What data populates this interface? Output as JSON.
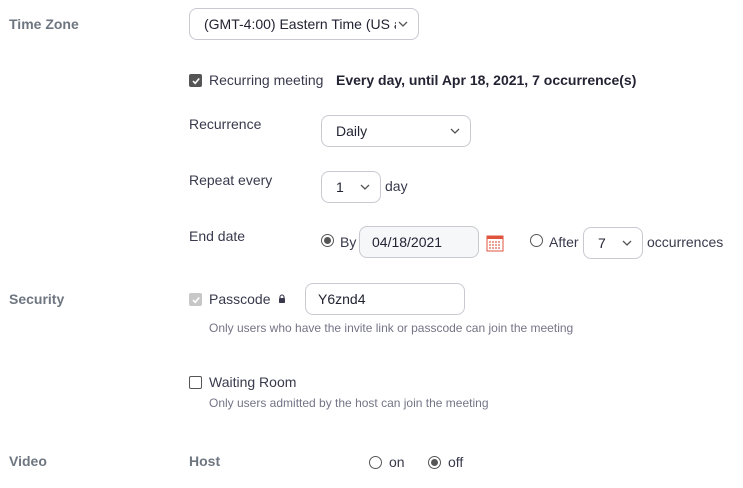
{
  "time_zone": {
    "section_label": "Time Zone",
    "value": "(GMT-4:00) Eastern Time (US a"
  },
  "recurring": {
    "checkbox_label": "Recurring meeting",
    "summary": "Every day, until Apr 18, 2021, 7 occurrence(s)",
    "checked": true,
    "recurrence_label": "Recurrence",
    "recurrence_value": "Daily",
    "repeat_label": "Repeat every",
    "repeat_value": "1",
    "repeat_unit": "day",
    "end_label": "End date",
    "by_label": "By",
    "by_selected": true,
    "end_date": "04/18/2021",
    "after_label": "After",
    "after_value": "7",
    "occurrences_label": "occurrences"
  },
  "security": {
    "section_label": "Security",
    "passcode_label": "Passcode",
    "passcode_value": "Y6znd4",
    "passcode_hint": "Only users who have the invite link or passcode can join the meeting",
    "waiting_room_label": "Waiting Room",
    "waiting_room_hint": "Only users admitted by the host can join the meeting"
  },
  "video": {
    "section_label": "Video",
    "host_label": "Host",
    "on_label": "on",
    "off_label": "off",
    "host_value": "off"
  },
  "icons": {
    "chevron": "chevron-down-icon",
    "calendar": "calendar-icon",
    "lock": "lock-icon",
    "check": "check-icon"
  },
  "colors": {
    "section_label": "#6e7680",
    "text": "#39394d",
    "border": "#c9c9d1",
    "calendar": "#e0533d"
  }
}
